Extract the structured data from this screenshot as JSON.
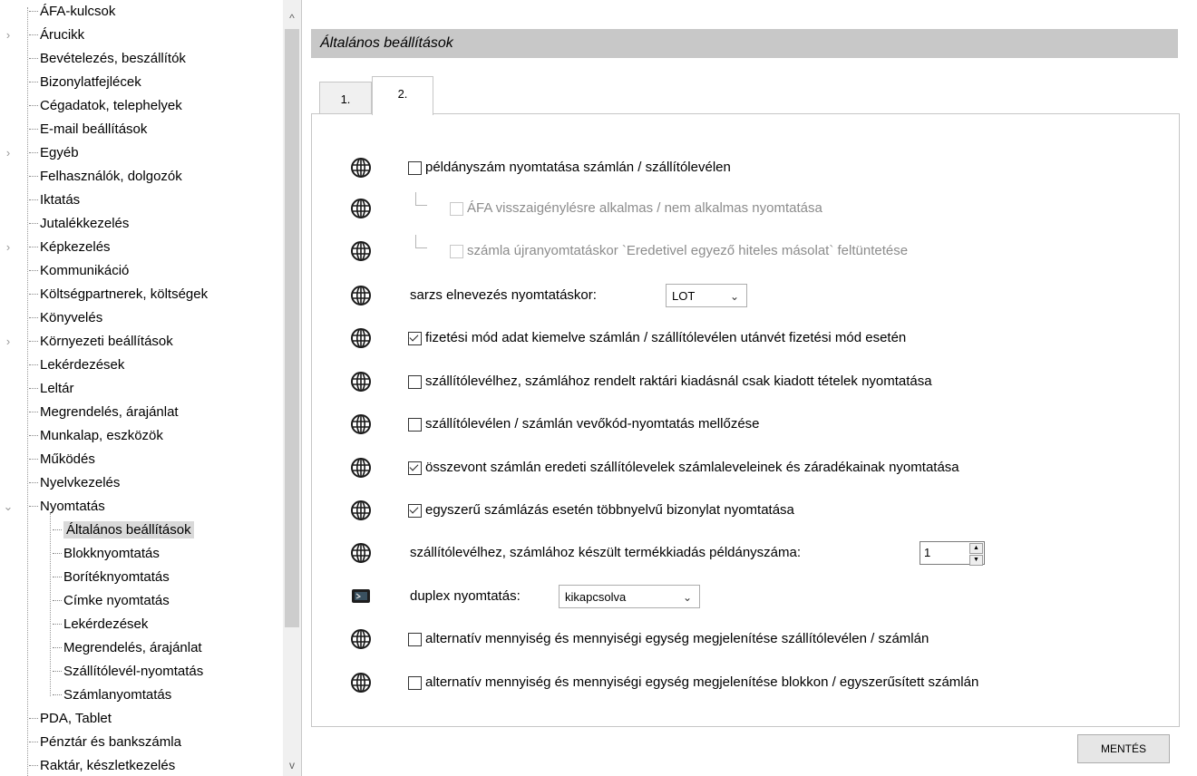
{
  "tree": {
    "items": [
      {
        "label": "ÁFA-kulcsok",
        "level": 0,
        "expander": ""
      },
      {
        "label": "Árucikk",
        "level": 0,
        "expander": ">"
      },
      {
        "label": "Bevételezés, beszállítók",
        "level": 0,
        "expander": ""
      },
      {
        "label": "Bizonylatfejlécek",
        "level": 0,
        "expander": ""
      },
      {
        "label": "Cégadatok, telephelyek",
        "level": 0,
        "expander": ""
      },
      {
        "label": "E-mail beállítások",
        "level": 0,
        "expander": ""
      },
      {
        "label": "Egyéb",
        "level": 0,
        "expander": ">"
      },
      {
        "label": "Felhasználók, dolgozók",
        "level": 0,
        "expander": ""
      },
      {
        "label": "Iktatás",
        "level": 0,
        "expander": ""
      },
      {
        "label": "Jutalékkezelés",
        "level": 0,
        "expander": ""
      },
      {
        "label": "Képkezelés",
        "level": 0,
        "expander": ">"
      },
      {
        "label": "Kommunikáció",
        "level": 0,
        "expander": ""
      },
      {
        "label": "Költségpartnerek, költségek",
        "level": 0,
        "expander": ""
      },
      {
        "label": "Könyvelés",
        "level": 0,
        "expander": ""
      },
      {
        "label": "Környezeti beállítások",
        "level": 0,
        "expander": ">"
      },
      {
        "label": "Lekérdezések",
        "level": 0,
        "expander": ""
      },
      {
        "label": "Leltár",
        "level": 0,
        "expander": ""
      },
      {
        "label": "Megrendelés, árajánlat",
        "level": 0,
        "expander": ""
      },
      {
        "label": "Munkalap, eszközök",
        "level": 0,
        "expander": ""
      },
      {
        "label": "Működés",
        "level": 0,
        "expander": ""
      },
      {
        "label": "Nyelvkezelés",
        "level": 0,
        "expander": ""
      },
      {
        "label": "Nyomtatás",
        "level": 0,
        "expander": "v"
      },
      {
        "label": "Általános beállítások",
        "level": 1,
        "expander": "",
        "selected": true
      },
      {
        "label": "Blokknyomtatás",
        "level": 1,
        "expander": ""
      },
      {
        "label": "Borítéknyomtatás",
        "level": 1,
        "expander": ""
      },
      {
        "label": "Címke nyomtatás",
        "level": 1,
        "expander": ""
      },
      {
        "label": "Lekérdezések",
        "level": 1,
        "expander": ""
      },
      {
        "label": "Megrendelés, árajánlat",
        "level": 1,
        "expander": ""
      },
      {
        "label": "Szállítólevél-nyomtatás",
        "level": 1,
        "expander": ""
      },
      {
        "label": "Számlanyomtatás",
        "level": 1,
        "expander": ""
      },
      {
        "label": "PDA, Tablet",
        "level": 0,
        "expander": ""
      },
      {
        "label": "Pénztár és bankszámla",
        "level": 0,
        "expander": ""
      },
      {
        "label": "Raktár, készletkezelés",
        "level": 0,
        "expander": ""
      }
    ],
    "scroll_up": "^",
    "scroll_down": "v"
  },
  "panel": {
    "title": "Általános beállítások",
    "tabs": [
      {
        "label": "1."
      },
      {
        "label": "2."
      }
    ],
    "active_tab": "2."
  },
  "settings": {
    "r1": {
      "label": "példányszám nyomtatása számlán / szállítólevélen",
      "checked": false,
      "icon": "globe-icon"
    },
    "r2": {
      "label": "ÁFA visszaigénylésre alkalmas / nem alkalmas nyomtatása",
      "checked": false,
      "disabled": true,
      "icon": "globe-icon"
    },
    "r3": {
      "label": "számla újranyomtatáskor `Eredetivel egyező hiteles másolat` feltüntetése",
      "checked": false,
      "disabled": true,
      "icon": "globe-icon"
    },
    "r4": {
      "label": "sarzs elnevezés nyomtatáskor:",
      "value": "LOT",
      "icon": "globe-icon"
    },
    "r5": {
      "label": "fizetési mód adat kiemelve számlán / szállítólevélen utánvét fizetési mód esetén",
      "checked": true,
      "icon": "globe-icon"
    },
    "r6": {
      "label": "szállítólevélhez, számlához rendelt raktári kiadásnál csak kiadott tételek nyomtatása",
      "checked": false,
      "icon": "globe-icon"
    },
    "r7": {
      "label": "szállítólevélen / számlán vevőkód-nyomtatás mellőzése",
      "checked": false,
      "icon": "globe-icon"
    },
    "r8": {
      "label": "összevont számlán eredeti szállítólevelek számlaleveleinek és záradékainak nyomtatása",
      "checked": true,
      "icon": "globe-icon"
    },
    "r9": {
      "label": "egyszerű számlázás esetén többnyelvű bizonylat nyomtatása",
      "checked": true,
      "icon": "globe-icon"
    },
    "r10": {
      "label": "szállítólevélhez, számlához készült termékkiadás példányszáma:",
      "value": "1",
      "icon": "globe-icon"
    },
    "r11": {
      "label": "duplex nyomtatás:",
      "value": "kikapcsolva",
      "icon": "monitor-icon"
    },
    "r12": {
      "label": "alternatív mennyiség és mennyiségi egység megjelenítése szállítólevélen / számlán",
      "checked": false,
      "icon": "globe-icon"
    },
    "r13": {
      "label": "alternatív mennyiség és mennyiségi egység megjelenítése blokkon / egyszerűsített számlán",
      "checked": false,
      "icon": "globe-icon"
    }
  },
  "save_label": "MENTÉS"
}
